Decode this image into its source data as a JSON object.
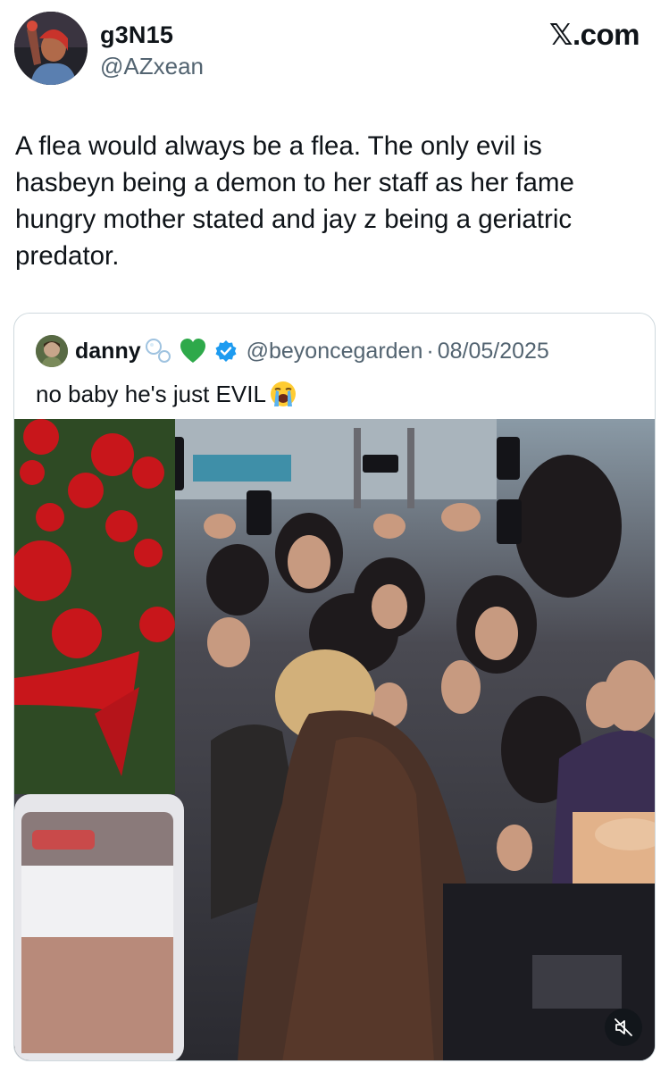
{
  "author": {
    "display_name": "g3N15",
    "handle": "@AZxean",
    "avatar_icon": "profile-photo"
  },
  "brand": {
    "label": "𝕏.com"
  },
  "tweet": {
    "text": "A flea would always be a flea. The only evil is hasbeyn being a demon to her staff as her fame hungry mother stated and jay z being a geriatric predator."
  },
  "quote": {
    "display_name": "danny",
    "name_emojis": [
      "bubbles-emoji",
      "green-heart-emoji"
    ],
    "verified_icon": "verified-badge-icon",
    "handle": "@beyoncegarden",
    "separator": "·",
    "date": "08/05/2025",
    "text": "no baby he's just EVIL",
    "text_emoji": "loudly-crying-face-emoji",
    "media": {
      "type": "video",
      "mute_icon": "muted-speaker-icon",
      "accent_colors": {
        "flowers": "#c8161b",
        "crowd_bg": "#5a5a60",
        "barrier": "#1c1c22"
      }
    }
  },
  "colors": {
    "text": "#0f1419",
    "secondary": "#536471",
    "border": "#cfd9de",
    "verified": "#1d9bf0"
  }
}
